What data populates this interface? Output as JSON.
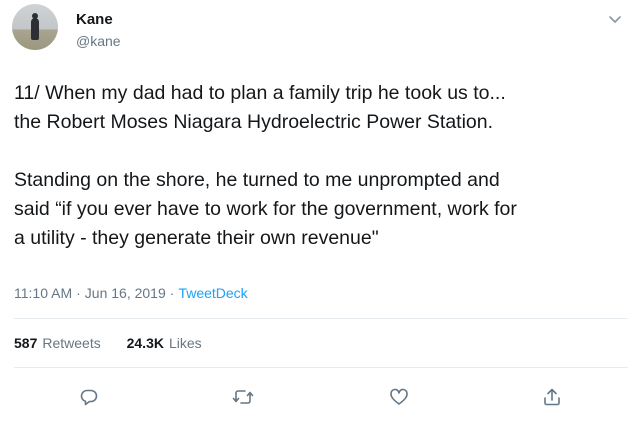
{
  "author": {
    "name": "Kane",
    "handle": "@kane"
  },
  "tweet": {
    "text": "11/ When my dad had to plan a family trip he took us to...\nthe Robert Moses Niagara Hydroelectric Power Station.\n\nStanding on the shore, he turned to me unprompted and\nsaid “if you ever have to work for the government, work for\na utility - they generate their own revenue\"",
    "time": "11:10 AM",
    "date": "Jun 16, 2019",
    "separator": "·",
    "source": "TweetDeck"
  },
  "stats": {
    "retweets_count": "587",
    "retweets_label": "Retweets",
    "likes_count": "24.3K",
    "likes_label": "Likes"
  },
  "icons": {
    "caret": "chevron-down-icon",
    "reply": "reply-icon",
    "retweet": "retweet-icon",
    "like": "heart-icon",
    "share": "share-icon"
  },
  "colors": {
    "text": "#14171a",
    "muted": "#657786",
    "accent": "#1da1f2",
    "divider": "#e6ecf0"
  }
}
